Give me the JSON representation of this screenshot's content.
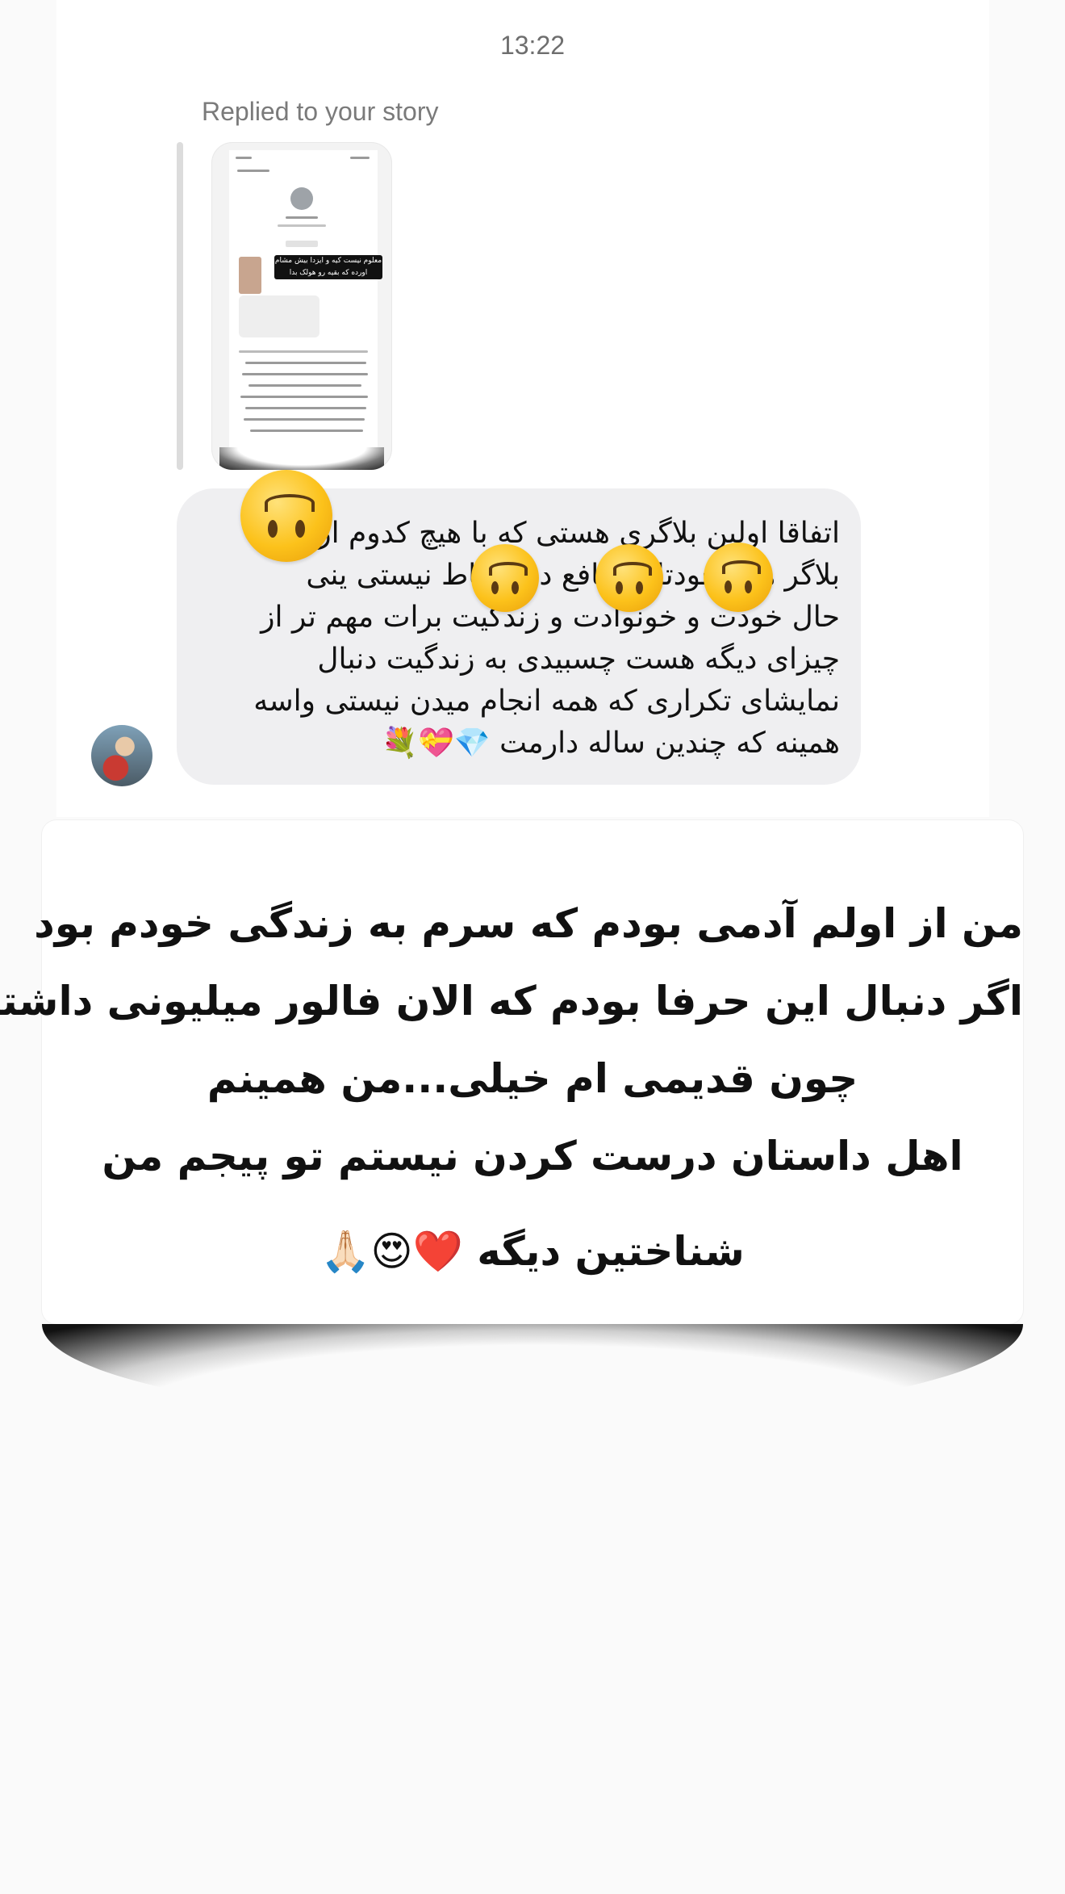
{
  "header": {
    "time": "13:22"
  },
  "reply": {
    "caption": "Replied to your story"
  },
  "story_preview": {
    "overlay_text": "معلوم نیست کیه و ایزدا بیش مشام اورده که بقیه رو هولک بدا"
  },
  "message": {
    "lines": [
      "اتفاقا اولین بلاگری هستی که با هیچ کدوم از",
      "بلاگر های خودتا و منافع در ارتباط نیستی ینی",
      "حال خودت و خونوادت و زندگیت برات مهم تر از",
      "چیزای دیگه هست چسبیدی به زندگیت دنبال",
      "نمایشای تکراری که همه انجام میدن نیستی واسه",
      "همینه که چندین ساله دارمت 💎💝💐"
    ],
    "reactions": [
      "upside-down-face",
      "upside-down-face",
      "upside-down-face",
      "upside-down-face"
    ]
  },
  "sender": {
    "avatar": "profile-avatar"
  },
  "story_card": {
    "lines": [
      "من از اولم آدمی بودم که سرم به زندگی خودم بود",
      "اگر دنبال این حرفا بودم که الان فالور میلیونی داشتم",
      "چون قدیمی ام خیلی...من همینم",
      "اهل داستان درست  کردن نیستم تو پیجم من",
      "شناختین دیگه ❤️😍🙏🏻"
    ]
  }
}
